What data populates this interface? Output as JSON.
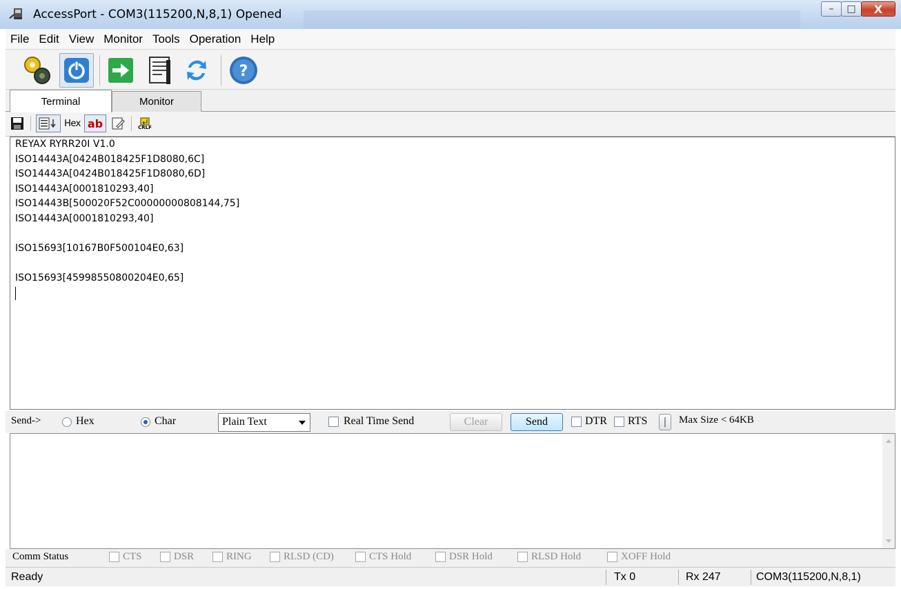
{
  "window": {
    "title": "AccessPort - COM3(115200,N,8,1) Opened",
    "controls": {
      "minimize": "–",
      "maximize": "□",
      "close": "X"
    }
  },
  "menu": [
    "File",
    "Edit",
    "View",
    "Monitor",
    "Tools",
    "Operation",
    "Help"
  ],
  "toolbar": {
    "icons": [
      "gear-config-icon",
      "power-icon",
      "arrow-right-icon",
      "document-icon",
      "refresh-arrows-icon",
      "help-icon"
    ]
  },
  "tabs": [
    "Terminal",
    "Monitor"
  ],
  "subtoolbar": {
    "hex_label": "Hex",
    "ab_label": "ab",
    "crlf_label": "CRLF"
  },
  "receive": {
    "lines": [
      "REYAX RYRR20I V1.0",
      "ISO14443A[0424B018425F1D8080,6C]",
      "ISO14443A[0424B018425F1D8080,6D]",
      "ISO14443A[0001810293,40]",
      "ISO14443B[500020F52C00000000808144,75]",
      "ISO14443A[0001810293,40]",
      "",
      "ISO15693[10167B0F500104E0,63]",
      "",
      "ISO15693[45998550800204E0,65]"
    ]
  },
  "send": {
    "label": "Send->",
    "hex_label": "Hex",
    "char_label": "Char",
    "selected_mode": "Char",
    "format_value": "Plain Text",
    "realtime_label": "Real Time Send",
    "clear_label": "Clear",
    "send_label": "Send",
    "dtr_label": "DTR",
    "rts_label": "RTS",
    "toggle_label": "|",
    "max_size_label": "Max Size < 64KB"
  },
  "comm_status": {
    "label": "Comm Status",
    "items": [
      "CTS",
      "DSR",
      "RING",
      "RLSD (CD)",
      "CTS Hold",
      "DSR Hold",
      "RLSD Hold",
      "XOFF Hold"
    ]
  },
  "status": {
    "ready": "Ready",
    "tx": "Tx 0",
    "rx": "Rx 247",
    "port": "COM3(115200,N,8,1)"
  }
}
